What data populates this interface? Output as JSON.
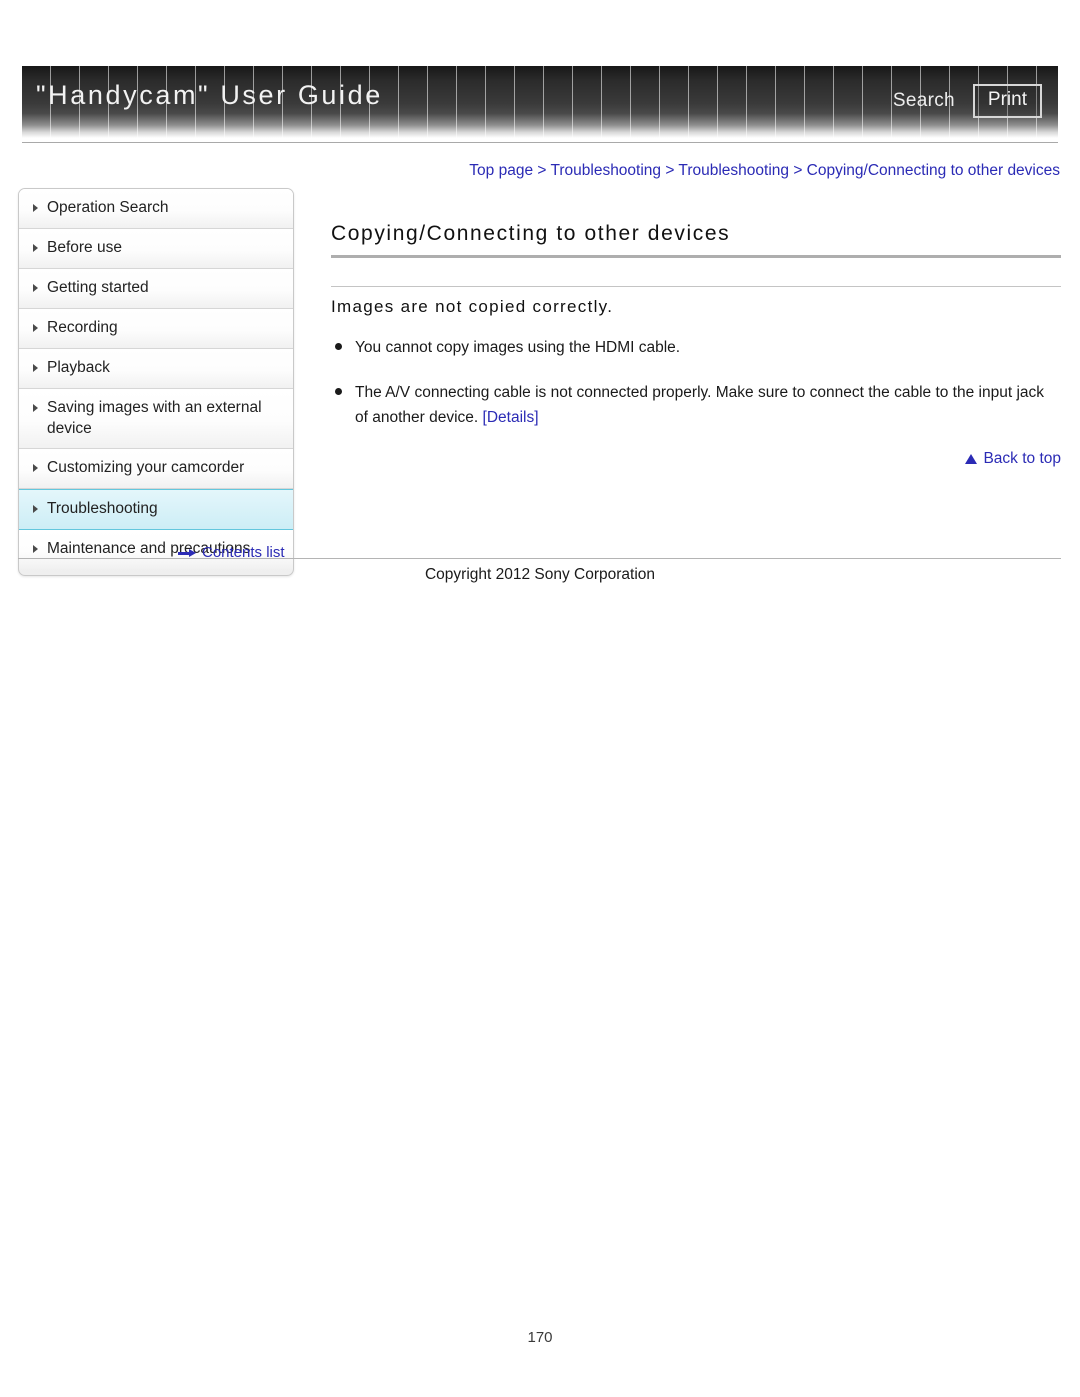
{
  "header": {
    "title": "\"Handycam\" User Guide",
    "search_label": "Search",
    "print_label": "Print"
  },
  "breadcrumb": {
    "text": "Top page > Troubleshooting > Troubleshooting > Copying/Connecting to other devices"
  },
  "sidebar": {
    "items": [
      {
        "label": "Operation Search",
        "selected": false
      },
      {
        "label": "Before use",
        "selected": false
      },
      {
        "label": "Getting started",
        "selected": false
      },
      {
        "label": "Recording",
        "selected": false
      },
      {
        "label": "Playback",
        "selected": false
      },
      {
        "label": "Saving images with an external device",
        "selected": false
      },
      {
        "label": "Customizing your camcorder",
        "selected": false
      },
      {
        "label": "Troubleshooting",
        "selected": true
      },
      {
        "label": "Maintenance and precautions",
        "selected": false
      }
    ],
    "contents_list_label": "Contents list"
  },
  "main": {
    "page_title": "Copying/Connecting to other devices",
    "section_title": "Images are not copied correctly.",
    "bullets": [
      {
        "text": "You cannot copy images using the HDMI cable.",
        "link": ""
      },
      {
        "text": "The A/V connecting cable is not connected properly. Make sure to connect the cable to the input jack of another device. ",
        "link": "[Details]"
      }
    ],
    "back_to_top_label": "Back to top"
  },
  "footer": {
    "copyright": "Copyright 2012 Sony Corporation",
    "page_number": "170"
  },
  "colors": {
    "link": "#2b2bb5",
    "selected_nav": "#cdeef6",
    "rule": "#aeaeae"
  }
}
